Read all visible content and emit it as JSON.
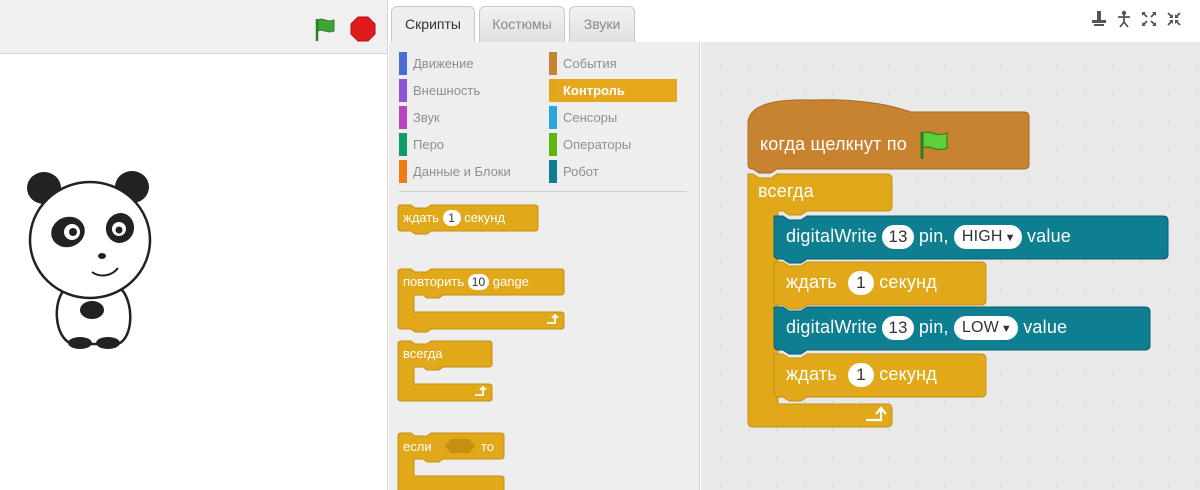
{
  "tabs": {
    "scripts": "Скрипты",
    "costumes": "Костюмы",
    "sounds": "Звуки"
  },
  "toolbar_icons": [
    "duplicate-icon",
    "delete-icon",
    "grow-icon",
    "shrink-icon"
  ],
  "categories": [
    {
      "label": "Движение",
      "color": "#4a6cd4"
    },
    {
      "label": "Внешность",
      "color": "#8a55d7"
    },
    {
      "label": "Звук",
      "color": "#bb42c3"
    },
    {
      "label": "Перо",
      "color": "#0e9a6c"
    },
    {
      "label": "Данные и Блоки",
      "color": "#ee7d16"
    },
    {
      "label": "События",
      "color": "#c88330"
    },
    {
      "label": "Контроль",
      "color": "#e1a91a"
    },
    {
      "label": "Сенсоры",
      "color": "#2ca5e2"
    },
    {
      "label": "Операторы",
      "color": "#5cb712"
    },
    {
      "label": "Робот",
      "color": "#0e7e91"
    }
  ],
  "selected_category": "Контроль",
  "palette_blocks": {
    "wait": {
      "text": "ждать",
      "value": "1",
      "suffix": "секунд"
    },
    "repeat": {
      "text": "повторить",
      "value": "10",
      "suffix": "gange"
    },
    "forever": {
      "text": "всегда"
    },
    "if_then": {
      "text": "если",
      "suffix": "то"
    }
  },
  "script": {
    "hat": "когда щелкнут по",
    "forever": "всегда",
    "dw1": {
      "label": "digitalWrite",
      "pin": "13",
      "pin_text": "pin,",
      "state": "HIGH",
      "value_text": "value"
    },
    "wait1": {
      "label": "ждать",
      "value": "1",
      "unit": "секунд"
    },
    "dw2": {
      "label": "digitalWrite",
      "pin": "13",
      "pin_text": "pin,",
      "state": "LOW",
      "value_text": "value"
    },
    "wait2": {
      "label": "ждать",
      "value": "1",
      "unit": "секунд"
    }
  },
  "colors": {
    "control": "#e1a91a",
    "control_dark": "#c48f12",
    "events": "#c88330",
    "robot": "#0e7e91",
    "flag_green": "#3fa535",
    "stop_red": "#e01b1b"
  }
}
